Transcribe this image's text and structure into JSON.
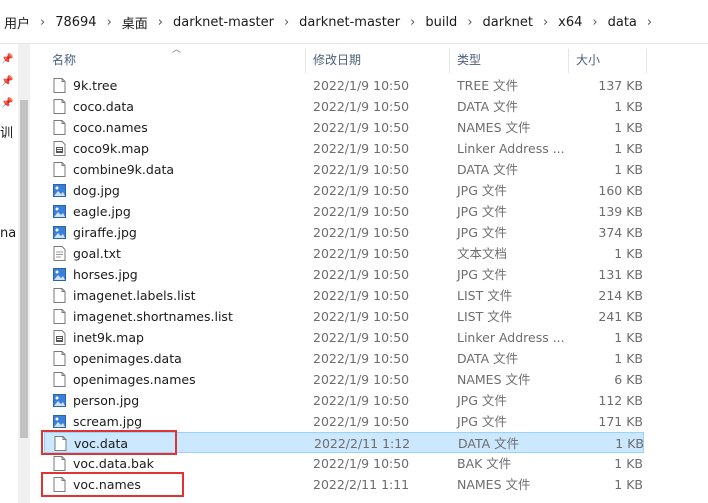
{
  "breadcrumb": [
    "用户",
    "78694",
    "桌面",
    "darknet-master",
    "darknet-master",
    "build",
    "darknet",
    "x64",
    "data"
  ],
  "left_nav": {
    "clipped_labels": [
      "训",
      "na"
    ]
  },
  "columns": {
    "name": "名称",
    "date": "修改日期",
    "type": "类型",
    "size": "大小"
  },
  "files": [
    {
      "name": "9k.tree",
      "date": "2022/1/9 10:50",
      "type": "TREE 文件",
      "size": "137 KB",
      "icon": "file-icon"
    },
    {
      "name": "coco.data",
      "date": "2022/1/9 10:50",
      "type": "DATA 文件",
      "size": "1 KB",
      "icon": "file-icon"
    },
    {
      "name": "coco.names",
      "date": "2022/1/9 10:50",
      "type": "NAMES 文件",
      "size": "1 KB",
      "icon": "file-icon"
    },
    {
      "name": "coco9k.map",
      "date": "2022/1/9 10:50",
      "type": "Linker Address ...",
      "size": "1 KB",
      "icon": "map-file-icon"
    },
    {
      "name": "combine9k.data",
      "date": "2022/1/9 10:50",
      "type": "DATA 文件",
      "size": "1 KB",
      "icon": "file-icon"
    },
    {
      "name": "dog.jpg",
      "date": "2022/1/9 10:50",
      "type": "JPG 文件",
      "size": "160 KB",
      "icon": "image-file-icon"
    },
    {
      "name": "eagle.jpg",
      "date": "2022/1/9 10:50",
      "type": "JPG 文件",
      "size": "139 KB",
      "icon": "image-file-icon"
    },
    {
      "name": "giraffe.jpg",
      "date": "2022/1/9 10:50",
      "type": "JPG 文件",
      "size": "374 KB",
      "icon": "image-file-icon"
    },
    {
      "name": "goal.txt",
      "date": "2022/1/9 10:50",
      "type": "文本文档",
      "size": "1 KB",
      "icon": "text-file-icon"
    },
    {
      "name": "horses.jpg",
      "date": "2022/1/9 10:50",
      "type": "JPG 文件",
      "size": "131 KB",
      "icon": "image-file-icon"
    },
    {
      "name": "imagenet.labels.list",
      "date": "2022/1/9 10:50",
      "type": "LIST 文件",
      "size": "214 KB",
      "icon": "file-icon"
    },
    {
      "name": "imagenet.shortnames.list",
      "date": "2022/1/9 10:50",
      "type": "LIST 文件",
      "size": "241 KB",
      "icon": "file-icon"
    },
    {
      "name": "inet9k.map",
      "date": "2022/1/9 10:50",
      "type": "Linker Address ...",
      "size": "1 KB",
      "icon": "map-file-icon"
    },
    {
      "name": "openimages.data",
      "date": "2022/1/9 10:50",
      "type": "DATA 文件",
      "size": "1 KB",
      "icon": "file-icon"
    },
    {
      "name": "openimages.names",
      "date": "2022/1/9 10:50",
      "type": "NAMES 文件",
      "size": "6 KB",
      "icon": "file-icon"
    },
    {
      "name": "person.jpg",
      "date": "2022/1/9 10:50",
      "type": "JPG 文件",
      "size": "112 KB",
      "icon": "image-file-icon"
    },
    {
      "name": "scream.jpg",
      "date": "2022/1/9 10:50",
      "type": "JPG 文件",
      "size": "171 KB",
      "icon": "image-file-icon"
    },
    {
      "name": "voc.data",
      "date": "2022/2/11 1:12",
      "type": "DATA 文件",
      "size": "1 KB",
      "icon": "file-icon",
      "selected": true,
      "highlighted": true
    },
    {
      "name": "voc.data.bak",
      "date": "2022/1/9 10:50",
      "type": "BAK 文件",
      "size": "1 KB",
      "icon": "file-icon"
    },
    {
      "name": "voc.names",
      "date": "2022/2/11 1:11",
      "type": "NAMES 文件",
      "size": "1 KB",
      "icon": "file-icon",
      "highlighted": true
    }
  ],
  "colors": {
    "selection_bg": "#cce8ff",
    "selection_border": "#99d1ff",
    "annotation_red": "#e03333",
    "header_text": "#4c607a",
    "image_icon_blue": "#3a7fd8"
  }
}
